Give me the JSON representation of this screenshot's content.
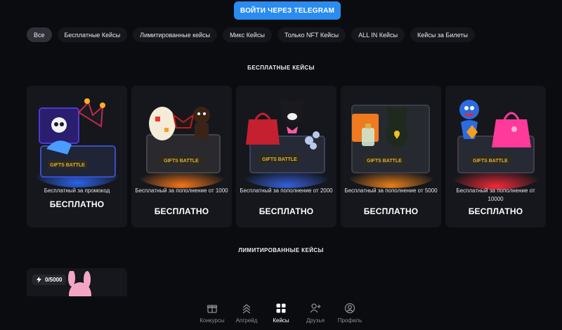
{
  "header": {
    "login_label": "ВОЙТИ ЧЕРЕЗ TELEGRAM"
  },
  "filters": [
    {
      "label": "Все",
      "active": true
    },
    {
      "label": "Бесплатные Кейсы"
    },
    {
      "label": "Лимитированные кейсы"
    },
    {
      "label": "Микс Кейсы"
    },
    {
      "label": "Только NFT Кейсы"
    },
    {
      "label": "ALL IN Кейсы"
    },
    {
      "label": "Кейсы за Билеты"
    }
  ],
  "free_section": {
    "title": "БЕСПЛАТНЫЕ КЕЙСЫ",
    "cards": [
      {
        "condition": "Бесплатный за промокод",
        "price": "БЕСПЛАТНО",
        "box_label": "GIFTS BATTLE",
        "glow": "#2d6bff",
        "icon": "skull-jester-box"
      },
      {
        "condition": "Бесплатный за пополнение от 1000",
        "price": "БЕСПЛАТНО",
        "box_label": "GIFTS BATTLE",
        "glow": "#ff7a1a",
        "icon": "egg-gingerbread-box"
      },
      {
        "condition": "Бесплатный за пополнение от 2000",
        "price": "БЕСПЛАТНО",
        "box_label": "GIFTS BATTLE",
        "glow": "#3a6cff",
        "icon": "bag-bear-box"
      },
      {
        "condition": "Бесплатный за пополнение от 5000",
        "price": "БЕСПЛАТНО",
        "box_label": "GIFTS BATTLE",
        "glow": "#ff8a1a",
        "icon": "perfume-bear-box"
      },
      {
        "condition": "Бесплатный за пополнение от 10000",
        "price": "БЕСПЛАТНО",
        "box_label": "GIFTS BATTLE",
        "glow": "#ff2a3a",
        "icon": "toy-bag-box"
      }
    ]
  },
  "limited_section": {
    "title": "ЛИМИТИРОВАННЫЕ КЕЙСЫ",
    "cards": [
      {
        "counter": "0/5000",
        "icon": "bunny-box"
      }
    ]
  },
  "bottom_nav": [
    {
      "label": "Конкурсы",
      "icon": "gift-icon"
    },
    {
      "label": "Апгрейд",
      "icon": "upgrade-icon"
    },
    {
      "label": "Кейсы",
      "icon": "cases-icon",
      "active": true
    },
    {
      "label": "Друзья",
      "icon": "add-friend-icon"
    },
    {
      "label": "Профиль",
      "icon": "profile-icon"
    }
  ]
}
